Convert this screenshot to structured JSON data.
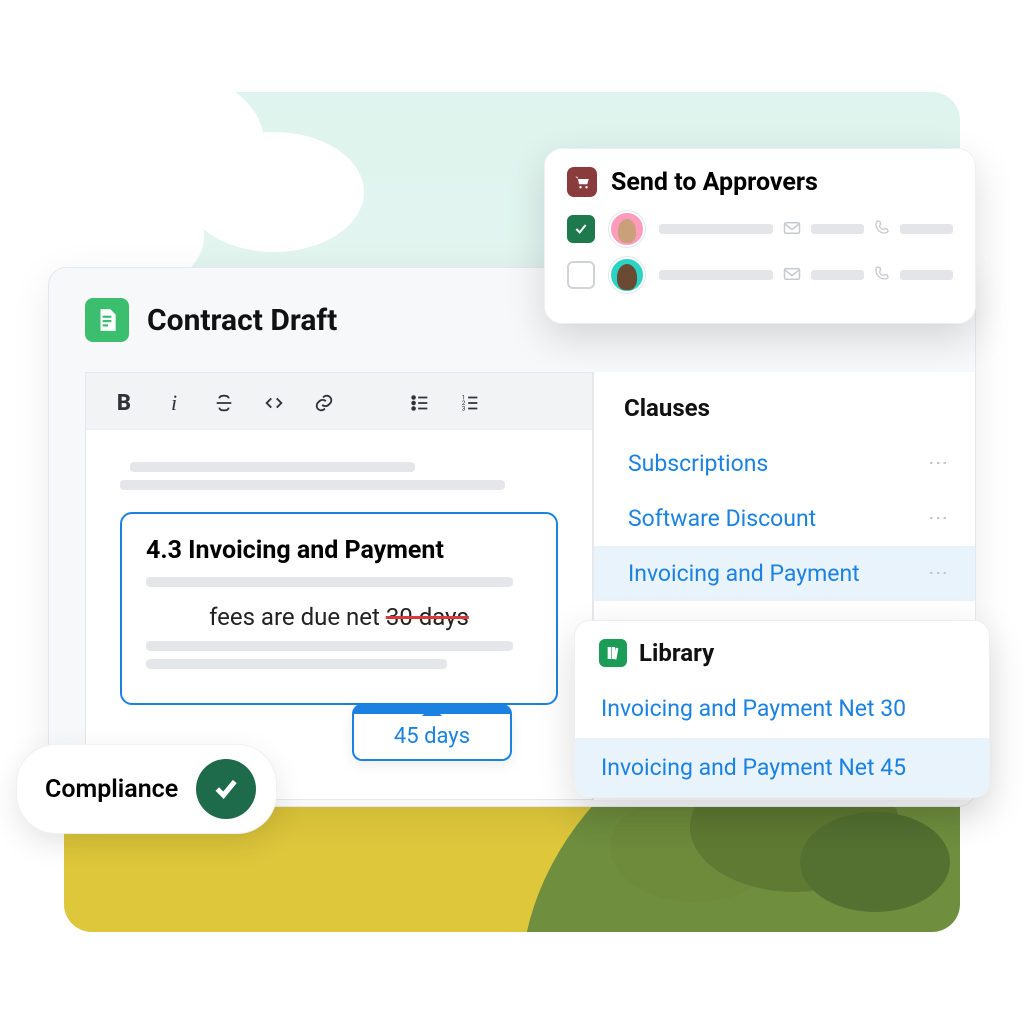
{
  "contract": {
    "title": "Contract Draft"
  },
  "clause_box": {
    "heading": "4.3 Invoicing and Payment",
    "line_prefix": "fees are due net ",
    "old_value": "30 days",
    "suggested_value": "45 days"
  },
  "sidebar": {
    "title": "Clauses",
    "items": [
      {
        "label": "Subscriptions"
      },
      {
        "label": "Software Discount"
      },
      {
        "label": "Invoicing and Payment"
      }
    ]
  },
  "library": {
    "title": "Library",
    "items": [
      {
        "label": "Invoicing and Payment Net 30"
      },
      {
        "label": "Invoicing and Payment Net 45"
      }
    ]
  },
  "approvers": {
    "title": "Send to Approvers"
  },
  "compliance": {
    "label": "Compliance"
  }
}
